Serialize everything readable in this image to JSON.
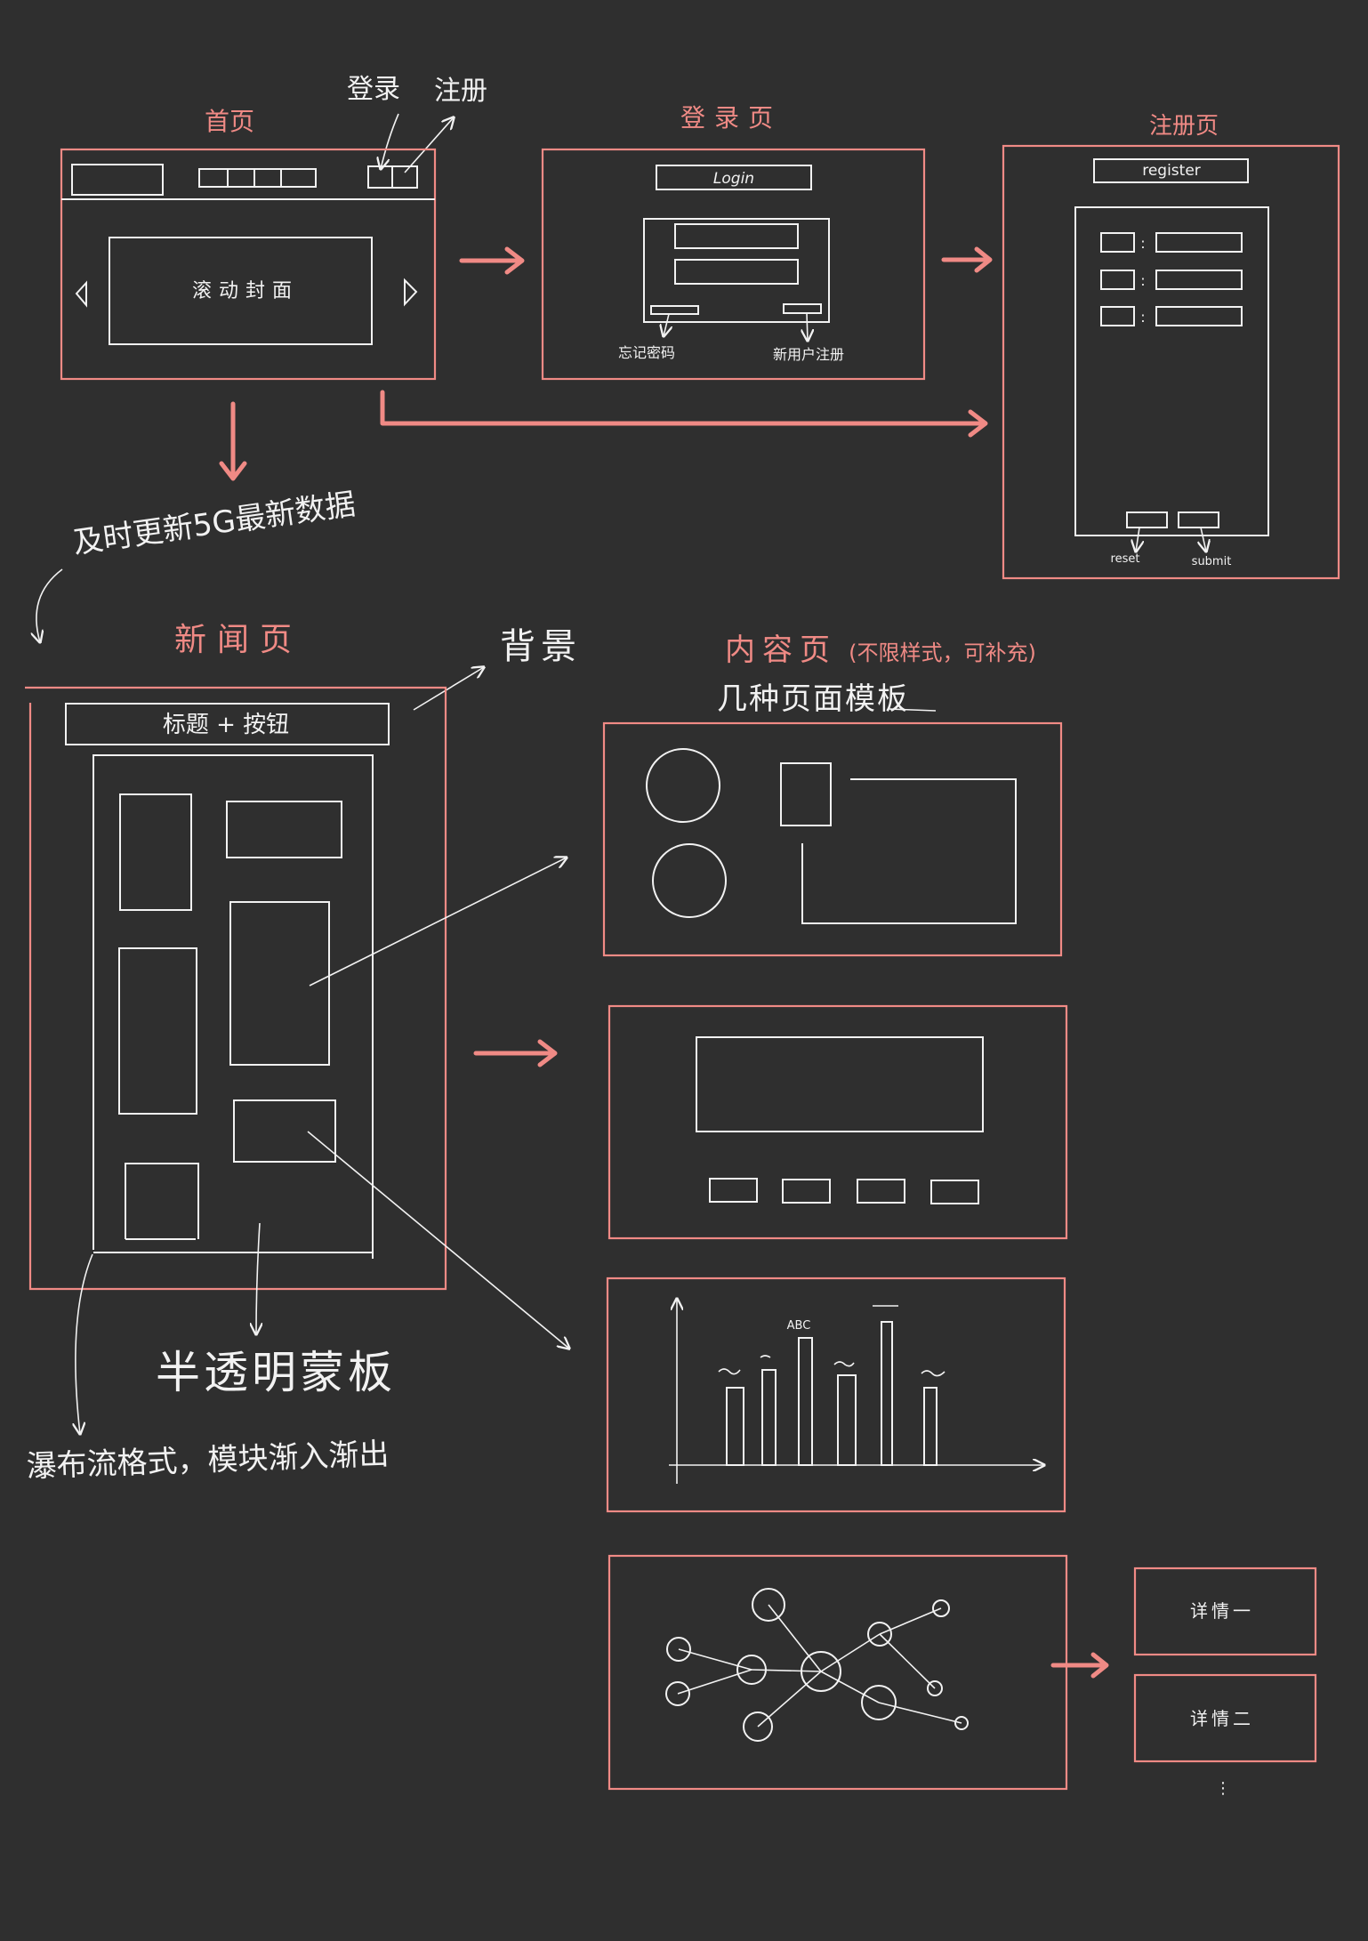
{
  "colors": {
    "background": "#2f2f2f",
    "accent": "#f08a85",
    "ink": "#f2f2f2"
  },
  "home": {
    "title": "首页",
    "login_label": "登录",
    "register_label": "注册",
    "carousel_label": "滚动封面"
  },
  "login_page": {
    "title": "登录页",
    "button_label": "Login",
    "forgot_password": "忘记密码",
    "new_user_register": "新用户注册"
  },
  "register_page": {
    "title": "注册页",
    "button_label": "register",
    "colon": ":",
    "reset_label": "reset",
    "submit_label": "submit"
  },
  "update_note": "及时更新5G最新数据",
  "news_page": {
    "title": "新闻页",
    "header_label": "标题 + 按钮",
    "background_note": "背景",
    "overlay_note": "半透明蒙板",
    "waterfall_note": "瀑布流格式，模块渐入渐出"
  },
  "content_page": {
    "title": "内容页",
    "title_note": "(不限样式，可补充)",
    "templates_note": "几种页面模板",
    "chart_label": "ABC"
  },
  "details": {
    "detail_one": "详情一",
    "detail_two": "详情二",
    "more": "⋮"
  }
}
